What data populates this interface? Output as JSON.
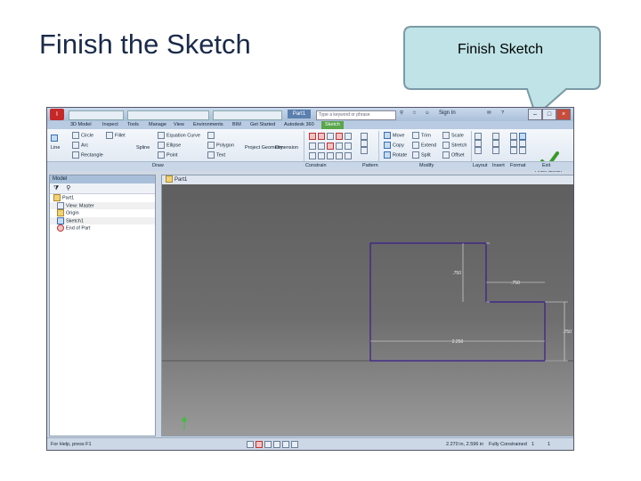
{
  "slide": {
    "title": "Finish the Sketch"
  },
  "callout": {
    "text": "Finish Sketch"
  },
  "window": {
    "doc_title": "Part1",
    "search_placeholder": "Type a keyword or phrase",
    "sign_in": "Sign In",
    "tabs": [
      "3D Model",
      "Inspect",
      "Tools",
      "Manage",
      "View",
      "Environments",
      "BIM",
      "Get Started",
      "Autodesk 360",
      "Sketch"
    ],
    "active_tab": "Sketch"
  },
  "ribbon": {
    "draw": {
      "line": "Line",
      "circle": "Circle",
      "arc": "Arc",
      "rectangle": "Rectangle",
      "fillet": "Fillet",
      "ellipse": "Ellipse",
      "point": "Point",
      "spline": "Spline",
      "equation_curve": "Equation Curve",
      "polygon": "Polygon",
      "text": "Text",
      "project_geometry": "Project Geometry",
      "dimension": "Dimension"
    },
    "modify": {
      "move": "Move",
      "copy": "Copy",
      "rotate": "Rotate",
      "trim": "Trim",
      "extend": "Extend",
      "split": "Split",
      "scale": "Scale",
      "stretch": "Stretch",
      "offset": "Offset"
    },
    "finish": {
      "label": "Finish Sketch"
    },
    "groups": [
      "Draw",
      "Constrain",
      "Pattern",
      "Modify",
      "Layout",
      "Insert",
      "Format",
      "Exit"
    ]
  },
  "browser": {
    "header": "Model",
    "items": [
      {
        "label": "Part1"
      },
      {
        "label": "View: Master"
      },
      {
        "label": "Origin"
      },
      {
        "label": "Sketch1"
      },
      {
        "label": "End of Part"
      }
    ]
  },
  "graphics": {
    "doc_tab": "Part1",
    "dimensions": {
      "left_height": ".750",
      "step_width": ".750",
      "right_height": ".750",
      "total_width": "2.250"
    }
  },
  "status": {
    "help": "For Help, press F1",
    "coords": "2.270 in, 2.596 in",
    "constraint": "Fully Constrained",
    "count_a": "1",
    "count_b": "1"
  }
}
